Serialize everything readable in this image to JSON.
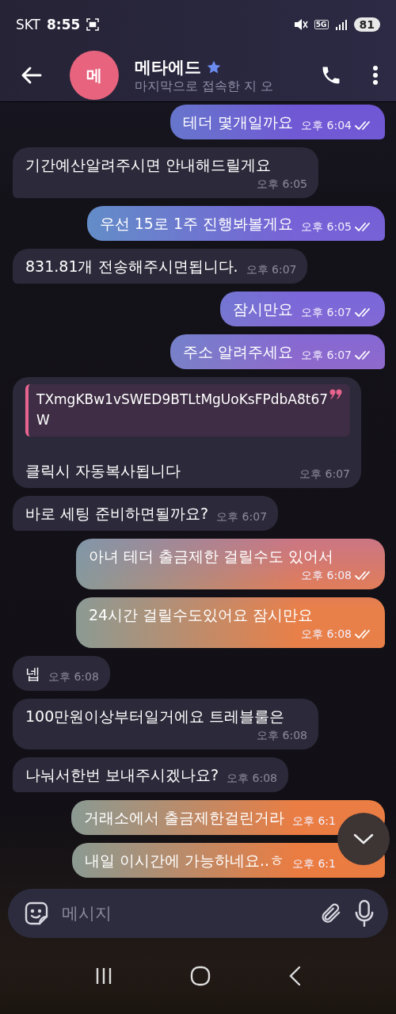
{
  "status_bar": {
    "carrier": "SKT",
    "time": "8:55",
    "network": "5G",
    "battery": "81"
  },
  "header": {
    "avatar_letter": "메",
    "name": "메타에드",
    "subtitle": "마지막으로 접속한 지 오"
  },
  "messages": [
    {
      "kind": "text",
      "outgoing": true,
      "text": "테더 몇개일까요",
      "time": "오후 6:04",
      "read": true
    },
    {
      "kind": "text",
      "outgoing": false,
      "text": "기간예산알려주시면 안내해드릴게요",
      "time": "오후 6:05"
    },
    {
      "kind": "text",
      "outgoing": true,
      "text": "우선 15로 1주 진행봐볼게요",
      "time": "오후 6:05",
      "read": true
    },
    {
      "kind": "text",
      "outgoing": false,
      "text": "831.81개 전송해주시면됩니다.",
      "time": "오후 6:07"
    },
    {
      "kind": "text",
      "outgoing": true,
      "text": "잠시만요",
      "time": "오후 6:07",
      "read": true
    },
    {
      "kind": "text",
      "outgoing": true,
      "text": "주소 알려주세요",
      "time": "오후 6:07",
      "read": true
    },
    {
      "kind": "quote",
      "outgoing": false,
      "quote": "TXmgKBw1vSWED9BTLtMgUoKsFPdbA8t67W",
      "text": "클릭시 자동복사됩니다",
      "time": "오후 6:07"
    },
    {
      "kind": "text",
      "outgoing": false,
      "text": "바로 세팅 준비하면될까요?",
      "time": "오후 6:07"
    },
    {
      "kind": "text",
      "outgoing": true,
      "text": "아녀 테더 출금제한 걸릴수도 있어서",
      "time": "오후 6:08",
      "read": true
    },
    {
      "kind": "text",
      "outgoing": true,
      "text": "24시간 걸릴수도있어요 잠시만요",
      "time": "오후 6:08",
      "read": true
    },
    {
      "kind": "text",
      "outgoing": false,
      "text": "넵",
      "time": "오후 6:08"
    },
    {
      "kind": "text",
      "outgoing": false,
      "text": "100만원이상부터일거에요 트레블룰은",
      "time": "오후 6:08"
    },
    {
      "kind": "text",
      "outgoing": false,
      "text": "나눠서한번 보내주시겠나요?",
      "time": "오후 6:08"
    },
    {
      "kind": "text",
      "outgoing": true,
      "text": "거래소에서 출금제한걸린거라",
      "time": "오후 6:1"
    },
    {
      "kind": "text",
      "outgoing": true,
      "text": "내일 이시간에 가능하네요..ㅎ",
      "time": "오후 6:1"
    }
  ],
  "composer": {
    "placeholder": "메시지"
  }
}
